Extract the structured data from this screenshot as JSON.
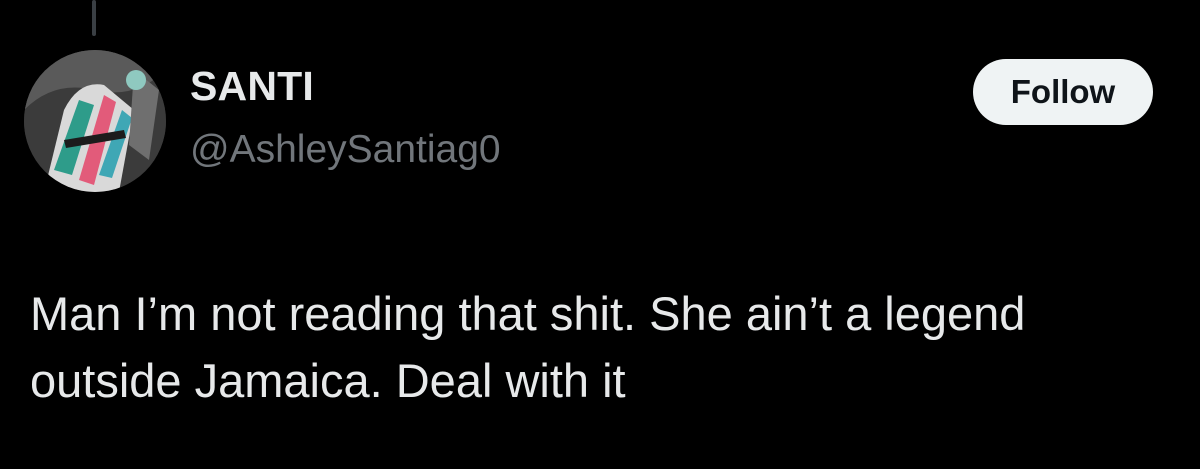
{
  "author": {
    "display_name": "SANTI",
    "handle": "@AshleySantiag0"
  },
  "actions": {
    "follow_label": "Follow"
  },
  "tweet": {
    "text_line1": "Man I’m not reading that shit. She ain’t a legend",
    "text_line2": "outside Jamaica. Deal with it"
  },
  "colors": {
    "background": "#000000",
    "primary_text": "#e7e9ea",
    "secondary_text": "#71767b",
    "follow_bg": "#eff3f4",
    "follow_text": "#0f1419"
  }
}
